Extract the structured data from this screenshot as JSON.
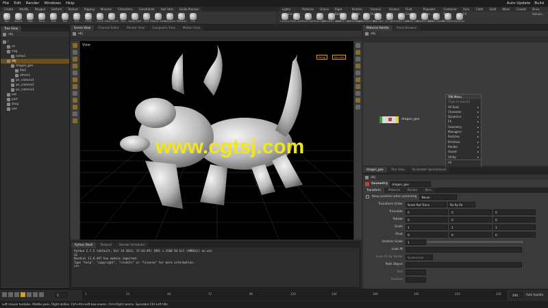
{
  "menubar": {
    "items": [
      "File",
      "Edit",
      "Render",
      "Windows",
      "Help"
    ],
    "desktop_label": "Auto Update",
    "desktop": "Build"
  },
  "shelf_left": {
    "tabs": [
      "Create",
      "Modify",
      "Polygon",
      "Deform",
      "Texture",
      "Rigging",
      "Muscles",
      "Characters",
      "Constraints",
      "Hair Utils",
      "Guide Process"
    ],
    "tools": [
      "Box",
      "Sphere",
      "Tube",
      "Torus",
      "Grid",
      "Null",
      "Line",
      "Circle",
      "Curve",
      "Draw Curve",
      "Path",
      "Spray Paint",
      "Font",
      "Platonic Solids",
      "L-System",
      "Metaball",
      "File"
    ]
  },
  "shelf_right": {
    "tabs": [
      "Lights and Ca...",
      "Particles",
      "Grains",
      "Rigid Bodies",
      "Particle Fluids",
      "Viscous Fluids",
      "Oceans",
      "Fluid Conta...",
      "Populate Cont...",
      "Container Tools",
      "Pyro FX",
      "Cloth",
      "Solid",
      "Wires",
      "Crowds",
      "Drive Simula..."
    ],
    "tools": [
      "Camera",
      "Point Light",
      "Spot Light",
      "Area Light",
      "Geometry Light",
      "Volume Light",
      "Distant Light",
      "Environment Light",
      "Sky Light",
      "GI Light",
      "Caustic Light",
      "Portal Light",
      "Ambient Light",
      "Stereo Camera",
      "VR Camera",
      "Switcher"
    ]
  },
  "left_panel": {
    "tab": "Tree View",
    "path": "obj",
    "rows": [
      {
        "label": "/",
        "indent": 0
      },
      {
        "label": "ch",
        "indent": 1
      },
      {
        "label": "img",
        "indent": 1
      },
      {
        "label": "comp1",
        "indent": 2
      },
      {
        "label": "obj",
        "indent": 1
      },
      {
        "label": "dragon_geo",
        "indent": 2
      },
      {
        "label": "file1",
        "indent": 3
      },
      {
        "label": "xform1",
        "indent": 3
      },
      {
        "label": "ipr_camera1",
        "indent": 2
      },
      {
        "label": "ipr_camera2",
        "indent": 2
      },
      {
        "label": "ipr_camera3",
        "indent": 2
      },
      {
        "label": "out",
        "indent": 1
      },
      {
        "label": "part",
        "indent": 1
      },
      {
        "label": "shop",
        "indent": 1
      },
      {
        "label": "vex",
        "indent": 1
      }
    ]
  },
  "viewer": {
    "tabs": [
      "Scene View",
      "Channel Editor",
      "Render View",
      "Composite View",
      "Motion View"
    ],
    "path": "obj",
    "label": "View",
    "persp": "Persp",
    "cam": "No cam"
  },
  "console": {
    "tabs": [
      "Python Shell",
      "Textport",
      "Render Scheduler"
    ],
    "lines": [
      "Python 2.7.5 (default, Oct 24 2013, 17:43:49) [MSC v.1500 64 bit (AMD64)] on win",
      "32",
      "Houdini 13.0.447 hou module imported.",
      "Type \"help\", \"copyright\", \"credits\" or \"license\" for more information.",
      ">>>"
    ]
  },
  "network": {
    "tabs": [
      "Material Palette",
      "Asset Browser"
    ],
    "path": "obj",
    "node_label": "dragon_geo",
    "menu": {
      "title": "TAB Menu",
      "search_placeholder": "(Type to search)",
      "items": [
        "All Tools",
        "Character",
        "Dynamics",
        "FX",
        "Geometry",
        "Managers",
        "Particles",
        "Primitive",
        "Render",
        "Sound",
        "Utility"
      ],
      "footer": [
        "All",
        "History",
        "Geometry"
      ]
    }
  },
  "params": {
    "tabs": [
      "dragon_geo",
      "Tree View",
      "Parameter Spreadsheet"
    ],
    "path": "obj",
    "node_type": "Geometry",
    "node_name": "dragon_geo",
    "subtabs": [
      "Transform",
      "Material",
      "Render",
      "Misc"
    ],
    "keep_position": "Keep position when parenting",
    "keep_value": "Never",
    "transform_order": {
      "label": "Transform Order",
      "a": "Scale Rot Trans",
      "b": "Rx Ry Rz"
    },
    "rows": [
      {
        "label": "Translate",
        "values": [
          "0",
          "0",
          "0"
        ]
      },
      {
        "label": "Rotate",
        "values": [
          "0",
          "0",
          "0"
        ]
      },
      {
        "label": "Scale",
        "values": [
          "1",
          "1",
          "1"
        ]
      },
      {
        "label": "Pivot",
        "values": [
          "0",
          "0",
          "0"
        ]
      }
    ],
    "uniform_scale": {
      "label": "Uniform Scale",
      "value": "1"
    },
    "look_at": "Look At",
    "look_up": {
      "label": "Look At Up Vector",
      "value": "Quaternion"
    },
    "path_object": "Path Object",
    "roll": "Roll",
    "position": "Position"
  },
  "timeline": {
    "frame": "1",
    "start": "1",
    "end": "240",
    "ticks": [
      "1",
      "24",
      "48",
      "72",
      "96",
      "120",
      "144",
      "168",
      "192",
      "216",
      "240"
    ],
    "right_label": "Auto Update"
  },
  "status_text": "Left mouse tumbles. Middle pans. Right dollies. Ctrl+Alt+Left box-zooms. Ctrl+Right zooms. Spacebar-Ctrl-Left tilts.",
  "watermark": "www.cgtsj.com",
  "colors": {
    "accent": "#d9a020",
    "watermark": "#f2e51a",
    "selection": "#6a5020"
  }
}
